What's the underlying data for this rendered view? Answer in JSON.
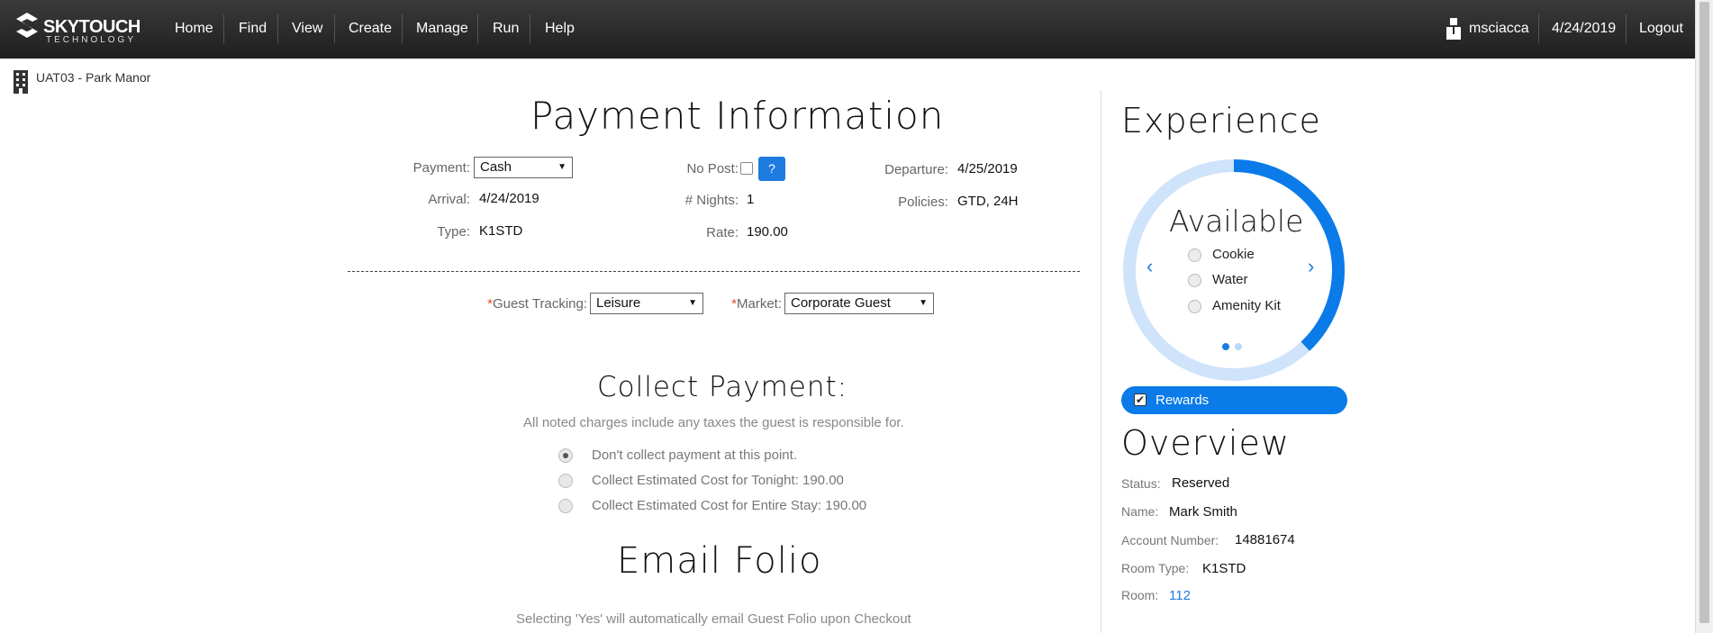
{
  "brand": {
    "name": "SKYTOUCH",
    "sub": "TECHNOLOGY"
  },
  "nav": {
    "items": [
      "Home",
      "Find",
      "View",
      "Create",
      "Manage",
      "Run",
      "Help"
    ]
  },
  "user": {
    "username": "msciacca",
    "date": "4/24/2019",
    "logout": "Logout"
  },
  "hotel": {
    "name": "UAT03 - Park Manor"
  },
  "payment_section": {
    "title": "Payment Information",
    "payment_label": "Payment:",
    "payment_value": "Cash",
    "no_post_label": "No Post:",
    "help_label": "?",
    "departure_label": "Departure:",
    "departure_value": "4/25/2019",
    "arrival_label": "Arrival:",
    "arrival_value": "4/24/2019",
    "nights_label": "# Nights:",
    "nights_value": "1",
    "policies_label": "Policies:",
    "policies_value": "GTD, 24H",
    "type_label": "Type:",
    "type_value": "K1STD",
    "rate_label": "Rate:",
    "rate_value": "190.00",
    "guest_tracking_label": "Guest Tracking:",
    "guest_tracking_value": "Leisure",
    "market_label": "Market:",
    "market_value": "Corporate Guest",
    "required_mark": "*"
  },
  "collect": {
    "title": "Collect Payment:",
    "note": "All noted charges include any taxes the guest is responsible for.",
    "options": [
      {
        "label": "Don't collect payment at this point.",
        "selected": true
      },
      {
        "label": "Collect Estimated Cost for Tonight: 190.00",
        "selected": false
      },
      {
        "label": "Collect Estimated Cost for Entire Stay: 190.00",
        "selected": false
      }
    ]
  },
  "email": {
    "title": "Email Folio",
    "note": "Selecting 'Yes' will automatically email Guest Folio upon Checkout"
  },
  "experience": {
    "title": "Experience",
    "available_title": "Available",
    "items": [
      "Cookie",
      "Water",
      "Amenity Kit"
    ],
    "ring_progress": 0.38,
    "page_count": 2,
    "active_page": 1,
    "rewards_label": "Rewards",
    "rewards_checked": true
  },
  "overview": {
    "title": "Overview",
    "status_label": "Status:",
    "status_value": "Reserved",
    "name_label": "Name:",
    "name_value": "Mark Smith",
    "account_label": "Account Number:",
    "account_value": "14881674",
    "room_type_label": "Room Type:",
    "room_type_value": "K1STD",
    "room_label": "Room:",
    "room_value": "112"
  },
  "colors": {
    "accent": "#1e7be0",
    "ring_track": "#cfe3fb",
    "topbar": "#2a2a2a"
  },
  "icons": {
    "brand": "skytouch-logo-icon",
    "user": "user-icon",
    "hotel": "building-icon"
  }
}
